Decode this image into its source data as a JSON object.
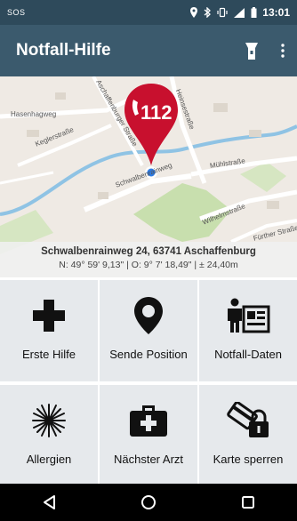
{
  "status_bar": {
    "left_text": "SOS",
    "time": "13:01",
    "icons": [
      "location-icon",
      "bluetooth-icon",
      "vibrate-icon",
      "signal-icon",
      "battery-icon"
    ]
  },
  "app_bar": {
    "title": "Notfall-Hilfe",
    "actions": [
      "flashlight-icon",
      "more-vert-icon"
    ]
  },
  "map": {
    "marker_number": "112",
    "streets": [
      "Hasenhagweg",
      "Keglerstraße",
      "Schwalbenrainweg",
      "Mühlstraße",
      "Wilhelmstraße",
      "Heinsestraße",
      "Aschaffenburger Straße",
      "Fürther Straße"
    ],
    "address": "Schwalbenrainweg 24, 63741 Aschaffenburg",
    "coordinates": "N: 49° 59' 9,13\" | O: 9° 7' 18,49\" | ± 24,40m",
    "colors": {
      "marker": "#c8102e",
      "water": "#8fc3e4",
      "park": "#c8dfae"
    }
  },
  "tiles": [
    {
      "label": "Erste Hilfe",
      "icon": "cross-icon"
    },
    {
      "label": "Sende Position",
      "icon": "location-pin-icon"
    },
    {
      "label": "Notfall-Daten",
      "icon": "person-id-icon"
    },
    {
      "label": "Allergien",
      "icon": "allergy-icon"
    },
    {
      "label": "Nächster Arzt",
      "icon": "medical-kit-icon"
    },
    {
      "label": "Karte sperren",
      "icon": "lock-card-icon"
    }
  ],
  "nav_bar": [
    "back-icon",
    "home-icon",
    "recents-icon"
  ],
  "theme": {
    "status_bar": "#2e4a5b",
    "app_bar": "#3b5a6d",
    "tile_bg": "#e6e9ec"
  }
}
